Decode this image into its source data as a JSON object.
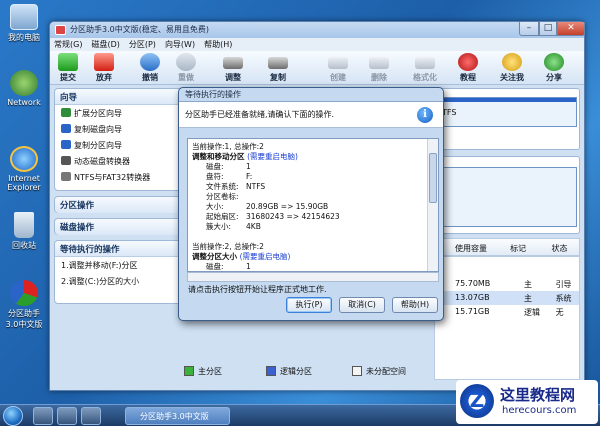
{
  "desktop": {
    "icons": [
      {
        "label": "我的电脑",
        "icon": "computer-icon"
      },
      {
        "label": "Network",
        "icon": "network-icon"
      },
      {
        "label": "Internet Explorer",
        "icon": "ie-icon"
      },
      {
        "label": "回收站",
        "icon": "recycle-bin-icon"
      },
      {
        "label": "分区助手3.0中文版",
        "icon": "partition-assistant-icon"
      }
    ]
  },
  "window": {
    "title": "分区助手3.0中文版(稳定、易用且免费)",
    "menu": [
      "常规(G)",
      "磁盘(D)",
      "分区(P)",
      "向导(W)",
      "帮助(H)"
    ],
    "toolbar": [
      {
        "label": "提交",
        "icon": "commit-icon",
        "enabled": true
      },
      {
        "label": "放弃",
        "icon": "discard-icon",
        "enabled": true
      },
      {
        "label": "撤销",
        "icon": "undo-icon",
        "enabled": true
      },
      {
        "label": "重做",
        "icon": "redo-icon",
        "enabled": false
      },
      {
        "label": "调整",
        "icon": "resize-icon",
        "enabled": true
      },
      {
        "label": "复制",
        "icon": "copy-icon",
        "enabled": true
      },
      {
        "label": "创建",
        "icon": "create-icon",
        "enabled": false
      },
      {
        "label": "删除",
        "icon": "delete-icon",
        "enabled": false
      },
      {
        "label": "格式化",
        "icon": "format-icon",
        "enabled": false
      },
      {
        "label": "教程",
        "icon": "tutorial-icon",
        "enabled": true
      },
      {
        "label": "关注我",
        "icon": "follow-icon",
        "enabled": true
      },
      {
        "label": "分享",
        "icon": "share-icon",
        "enabled": true
      }
    ]
  },
  "sidebar": {
    "wizard": {
      "title": "向导",
      "items": [
        "扩展分区向导",
        "复制磁盘向导",
        "复制分区向导",
        "动态磁盘转换器",
        "NTFS与FAT32转换器"
      ]
    },
    "partition_ops": {
      "title": "分区操作"
    },
    "disk_ops": {
      "title": "磁盘操作"
    },
    "pending": {
      "title": "等待执行的操作",
      "items": [
        "1.调整并移动(F:)分区",
        "2.调整(C:)分区的大小"
      ]
    }
  },
  "right_panel": {
    "fs_label": "TFS",
    "columns": [
      "使用容量",
      "标记",
      "状态"
    ],
    "rows": [
      {
        "used": "75.70MB",
        "flag": "主",
        "status": "引导"
      },
      {
        "used": "13.07GB",
        "flag": "主",
        "status": "系统"
      },
      {
        "used": "15.71GB",
        "flag": "逻辑",
        "status": "无"
      }
    ]
  },
  "legend": [
    "主分区",
    "逻辑分区",
    "未分配空间"
  ],
  "dialog": {
    "title": "等待执行的操作",
    "header": "分区助手已经准备就绪,请确认下面的操作.",
    "ops": [
      {
        "index": "当前操作:1, 总操作:2",
        "title": "调整和移动分区",
        "note": "(需要重启电脑)",
        "fields": [
          {
            "k": "磁盘:",
            "v": "1"
          },
          {
            "k": "盘符:",
            "v": "F:"
          },
          {
            "k": "文件系统:",
            "v": "NTFS"
          },
          {
            "k": "分区卷标:",
            "v": ""
          },
          {
            "k": "大小:",
            "v": "20.89GB => 15.90GB"
          },
          {
            "k": "起始扇区:",
            "v": "31680243 => 42154623"
          },
          {
            "k": "簇大小:",
            "v": "4KB"
          }
        ]
      },
      {
        "index": "当前操作:2, 总操作:2",
        "title": "调整分区大小",
        "note": "(需要重启电脑)",
        "fields": [
          {
            "k": "磁盘:",
            "v": "1"
          }
        ]
      }
    ],
    "hint": "请点击执行按钮开始让程序正式地工作.",
    "buttons": {
      "execute": "执行(P)",
      "cancel": "取消(C)",
      "help": "帮助(H)"
    }
  },
  "taskbar": {
    "active_window": "分区助手3.0中文版"
  },
  "watermark": {
    "title": "这里教程网",
    "url": "herecours.com"
  }
}
